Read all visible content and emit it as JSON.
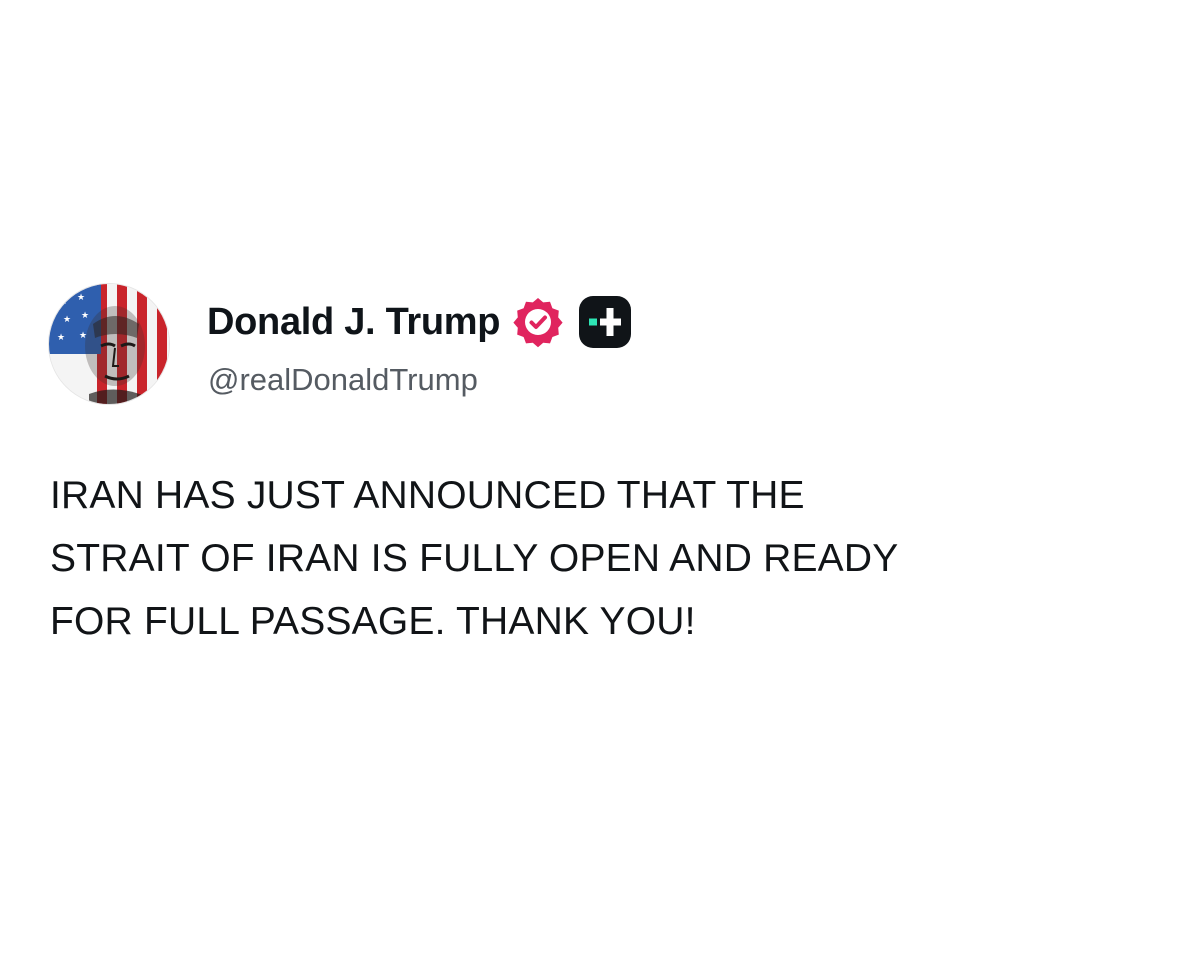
{
  "author": {
    "display_name": "Donald J. Trump",
    "handle": "@realDonaldTrump",
    "verified_icon": "verified-badge-icon",
    "app_icon": "platform-plus-icon",
    "avatar": "profile-avatar-flag-portrait"
  },
  "post": {
    "lines": [
      "IRAN HAS JUST ANNOUNCED THAT THE",
      "STRAIT OF IRAN IS FULLY OPEN AND READY",
      "FOR FULL PASSAGE. THANK YOU!"
    ]
  },
  "colors": {
    "background": "#ffffff",
    "text": "#111417",
    "handle": "#555b62",
    "verified_badge": "#e0245e",
    "app_icon_bg": "#101418",
    "app_icon_accent": "#2ee6b5"
  }
}
